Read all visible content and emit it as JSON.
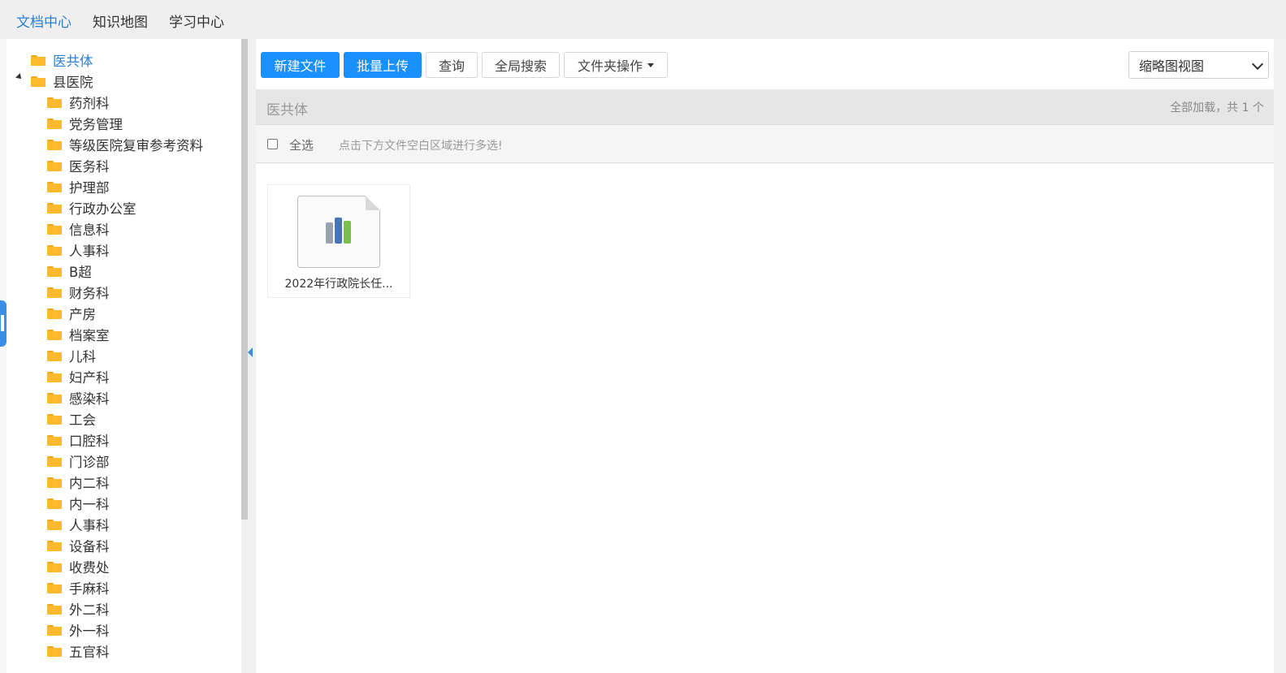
{
  "topnav": {
    "items": [
      {
        "label": "文档中心",
        "active": true
      },
      {
        "label": "知识地图",
        "active": false
      },
      {
        "label": "学习中心",
        "active": false
      }
    ]
  },
  "tree": {
    "root": "医共体",
    "parent": "县医院",
    "children": [
      "药剂科",
      "党务管理",
      "等级医院复审参考资料",
      "医务科",
      "护理部",
      "行政办公室",
      "信息科",
      "人事科",
      "B超",
      "财务科",
      "产房",
      "档案室",
      "儿科",
      "妇产科",
      "感染科",
      "工会",
      "口腔科",
      "门诊部",
      "内二科",
      "内一科",
      "人事科",
      "设备科",
      "收费处",
      "手麻科",
      "外二科",
      "外一科",
      "五官科"
    ]
  },
  "toolbar": {
    "new_file": "新建文件",
    "batch_upload": "批量上传",
    "query": "查询",
    "global_search": "全局搜索",
    "folder_ops": "文件夹操作",
    "view_mode": "缩略图视图"
  },
  "pathbar": {
    "crumb": "医共体",
    "count": "全部加载，共 1 个"
  },
  "selectbar": {
    "select_all": "全选",
    "hint": "点击下方文件空白区域进行多选!"
  },
  "files": [
    {
      "name": "2022年行政院长任..."
    }
  ],
  "colors": {
    "accent": "#1890ff",
    "active_link": "#2f7fd0",
    "folder": "#fbb92b"
  }
}
